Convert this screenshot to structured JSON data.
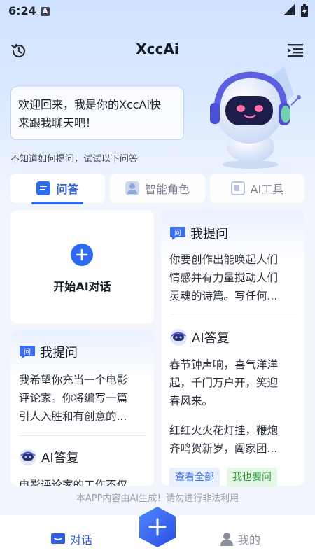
{
  "status_bar": {
    "time": "6:24",
    "indicator": "A"
  },
  "header": {
    "title": "XccAi",
    "history_icon": "history-icon",
    "menu_icon": "menu-icon"
  },
  "welcome": {
    "line1": "欢迎回来，我是你的XccAi快",
    "line2": "来跟我聊天吧！"
  },
  "hint": "不知道如何提问，试试以下问答",
  "tabs": [
    {
      "label": "问答",
      "icon": "qa-icon",
      "active": true
    },
    {
      "label": "智能角色",
      "icon": "role-icon",
      "active": false
    },
    {
      "label": "AI工具",
      "icon": "tool-icon",
      "active": false
    }
  ],
  "start_card": {
    "label": "开始AI对话"
  },
  "left_card": {
    "ask_title": "我提问",
    "question_lines": [
      "我希望你充当一个电影",
      "评论家。你将编写一篇",
      "引人入胜和有创意的..."
    ],
    "answer_title": "AI答复",
    "answer_partial": "电影评论家的工作不仅"
  },
  "right_card": {
    "ask_title": "我提问",
    "question_lines": [
      "你要创作出能唤起人们",
      "情感并有力量搅动人们",
      "灵魂的诗篇。写任何..."
    ],
    "answer_title": "AI答复",
    "answer_para1": [
      "春节钟声响，喜气洋洋",
      "起，千门万户开，笑迎",
      "春风来。"
    ],
    "answer_para2": [
      "红红火火花灯挂，鞭炮",
      "齐鸣贺新岁，阖家团..."
    ],
    "btn_view_all": "查看全部",
    "btn_ask_too": "我也要问"
  },
  "disclaimer": "本APP内容由AI生成！请勿进行非法利用",
  "bottom_nav": {
    "chat": "对话",
    "mine": "我的"
  },
  "colors": {
    "accent": "#2f6bf0",
    "green": "#2b9a3b"
  }
}
